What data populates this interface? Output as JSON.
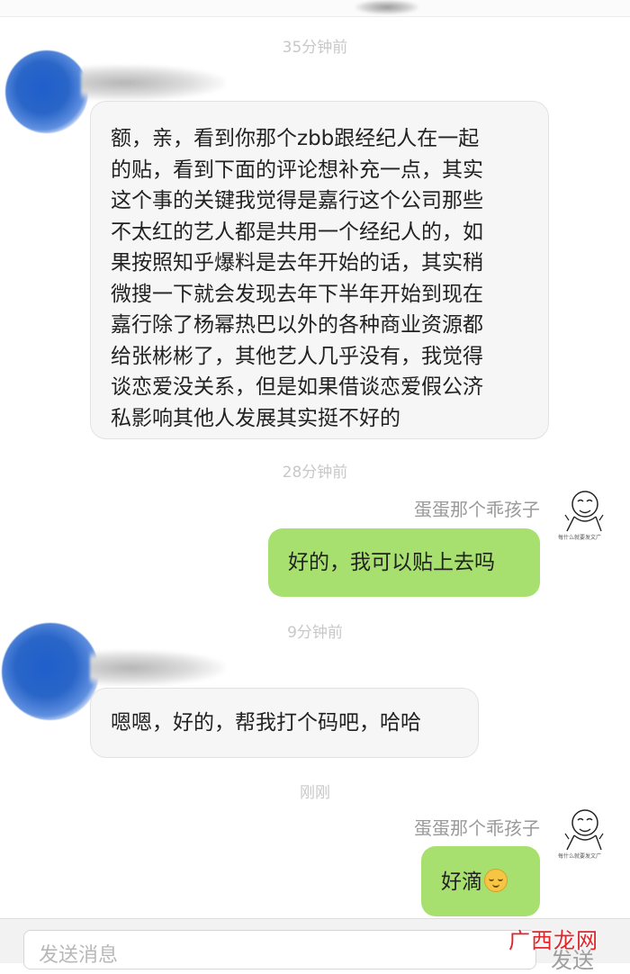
{
  "timestamps": [
    "35分钟前",
    "28分钟前",
    "9分钟前",
    "刚刚"
  ],
  "messages": [
    {
      "side": "incoming",
      "lines": [
        "额，亲，看到你那个zbb跟经纪人在一起",
        "的贴，看到下面的评论想补充一点，其实",
        "这个事的关键我觉得是嘉行这个公司那些",
        "不太红的艺人都是共用一个经纪人的，如",
        "果按照知乎爆料是去年开始的话，其实稍",
        "微搜一下就会发现去年下半年开始到现在",
        "嘉行除了杨幂热巴以外的各种商业资源都",
        "给张彬彬了，其他艺人几乎没有，我觉得",
        "谈恋爱没关系，但是如果借谈恋爱假公济",
        "私影响其他人发展其实挺不好的"
      ]
    },
    {
      "side": "outgoing",
      "sender": "蛋蛋那个乖孩子",
      "text": "好的，我可以贴上去吗"
    },
    {
      "side": "incoming",
      "text": "嗯嗯，好的，帮我打个码吧，哈哈"
    },
    {
      "side": "outgoing",
      "sender": "蛋蛋那个乖孩子",
      "text": "好滴",
      "emoji": "relieved-face-emoji"
    }
  ],
  "avatar_caption": "每什么就要发文广",
  "input": {
    "placeholder": "发送消息",
    "send_label": "发送"
  },
  "watermark": "广西龙网",
  "colors": {
    "outgoing_bubble": "#a8e070",
    "incoming_bubble": "#f6f6f6",
    "timestamp": "#c8c8c8",
    "avatar_blur": "#2a66c8",
    "watermark": "#e0262b"
  }
}
